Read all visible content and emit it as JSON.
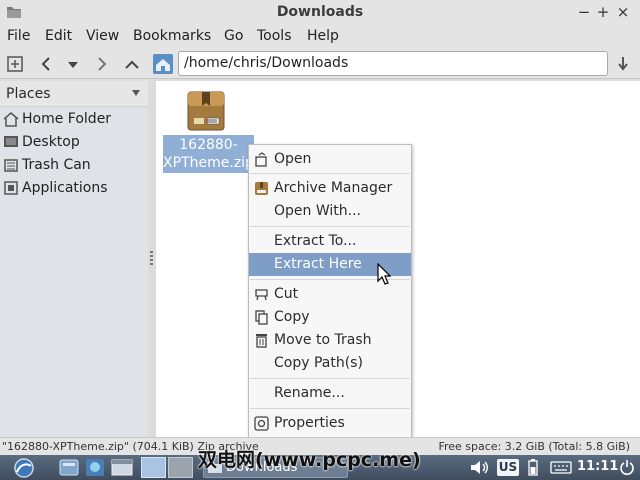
{
  "window": {
    "title": "Downloads",
    "btn_minimize": "−",
    "btn_maximize": "+",
    "btn_close": "×"
  },
  "menubar": [
    "File",
    "Edit",
    "View",
    "Bookmarks",
    "Go",
    "Tools",
    "Help"
  ],
  "toolbar": {
    "location": "/home/chris/Downloads",
    "icons": [
      "new-tab-icon",
      "back-icon",
      "history-dropdown-icon",
      "forward-icon",
      "up-icon",
      "home-icon",
      "go-icon"
    ]
  },
  "sidebar": {
    "header": "Places",
    "items": [
      {
        "label": "Home Folder",
        "icon": "home-icon"
      },
      {
        "label": "Desktop",
        "icon": "desktop-icon"
      },
      {
        "label": "Trash Can",
        "icon": "trash-icon"
      },
      {
        "label": "Applications",
        "icon": "applications-icon"
      }
    ]
  },
  "file": {
    "name_line1": "162880-",
    "name_line2": "XPTheme.zip",
    "icon": "zip-archive-icon"
  },
  "context_menu": {
    "open": "Open",
    "archive_manager": "Archive Manager",
    "open_with": "Open With...",
    "extract_to": "Extract To...",
    "extract_here": "Extract Here",
    "cut": "Cut",
    "copy": "Copy",
    "move_to_trash": "Move to Trash",
    "copy_paths": "Copy Path(s)",
    "rename": "Rename...",
    "properties": "Properties",
    "highlighted": "Extract Here"
  },
  "statusbar": {
    "left": "\"162880-XPTheme.zip\" (704.1 KiB) Zip archive",
    "right": "Free space: 3.2 GiB (Total: 5.8 GiB)"
  },
  "taskbar": {
    "task_label": "Downloads",
    "keyboard_layout": "US",
    "clock": "11:11"
  },
  "watermark": "双电网(www.pcpc.me)",
  "colors": {
    "selection": "#8fafd7",
    "menu_highlight": "#7e9ec8",
    "taskbar": "#4b5a6c"
  }
}
